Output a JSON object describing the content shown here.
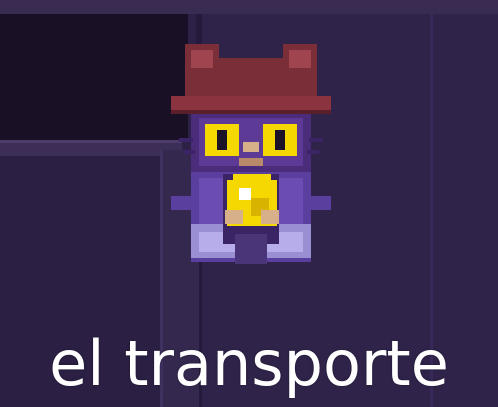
{
  "scene": {
    "caption": "el transporte",
    "character_icon": "niko-cat-sprite",
    "colors": {
      "background": "#2f2349",
      "dark_panel": "#1a1026",
      "hat": "#7a2e38",
      "eyes": "#f5d800",
      "cloak": "#5b3f9e",
      "caption_text": "#ffffff"
    }
  }
}
